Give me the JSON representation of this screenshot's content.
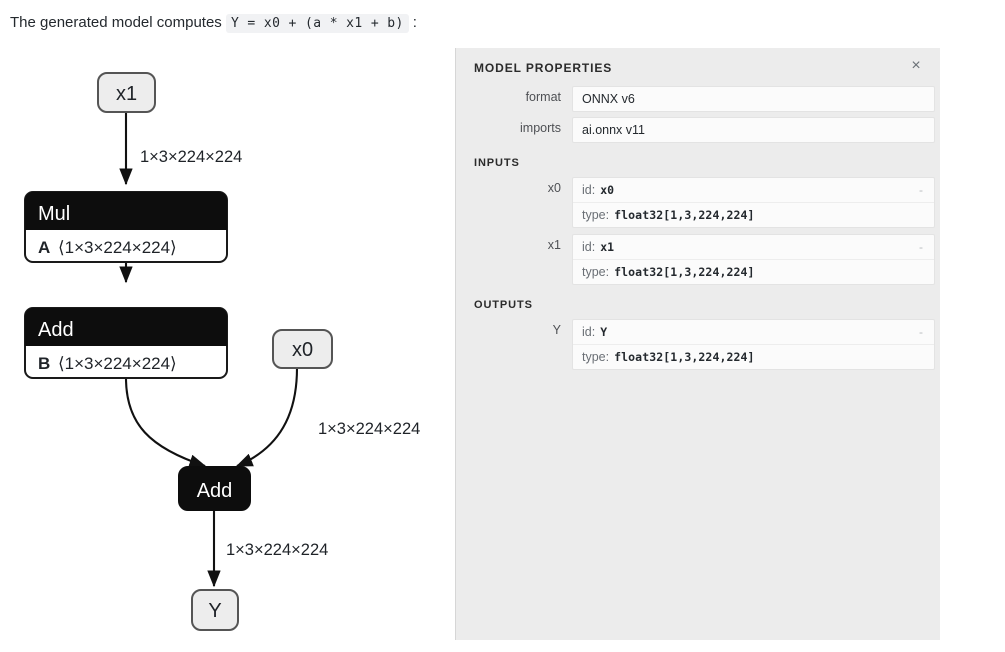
{
  "intro": {
    "text_before": "The generated model computes",
    "code": "Y = x0 + (a * x1 + b)",
    "text_after": ":"
  },
  "clipped_glyph": "}",
  "graph": {
    "nodes": [
      {
        "id": "x1",
        "kind": "io",
        "label": "x1"
      },
      {
        "id": "mul",
        "kind": "op",
        "title": "Mul",
        "arg_name": "A",
        "arg_shape": "⟨1×3×224×224⟩"
      },
      {
        "id": "add1",
        "kind": "op",
        "title": "Add",
        "arg_name": "B",
        "arg_shape": "⟨1×3×224×224⟩"
      },
      {
        "id": "x0",
        "kind": "io",
        "label": "x0"
      },
      {
        "id": "add2",
        "kind": "op-simple",
        "title": "Add"
      },
      {
        "id": "Y",
        "kind": "io",
        "label": "Y"
      }
    ],
    "edge_labels": {
      "x1_to_mul": "1×3×224×224",
      "x0_to_add2": "1×3×224×224",
      "add2_to_Y": "1×3×224×224"
    },
    "colors": {
      "op_header_bg": "#0d0d0d",
      "op_body_bg": "#ffffff",
      "io_bg": "#ededed",
      "io_border": "#555555",
      "edge": "#1a1a1a",
      "op_title_text": "#ffffff"
    }
  },
  "panel": {
    "title": "MODEL PROPERTIES",
    "close_icon": "×",
    "properties": [
      {
        "label": "format",
        "value": "ONNX v6"
      },
      {
        "label": "imports",
        "value": "ai.onnx v11"
      }
    ],
    "inputs_section_title": "INPUTS",
    "inputs": [
      {
        "name": "x0",
        "id_key": "id:",
        "id_value": "x0",
        "type_key": "type:",
        "type_value": "float32[1,3,224,224]",
        "trailing": "-"
      },
      {
        "name": "x1",
        "id_key": "id:",
        "id_value": "x1",
        "type_key": "type:",
        "type_value": "float32[1,3,224,224]",
        "trailing": "-"
      }
    ],
    "outputs_section_title": "OUTPUTS",
    "outputs": [
      {
        "name": "Y",
        "id_key": "id:",
        "id_value": "Y",
        "type_key": "type:",
        "type_value": "float32[1,3,224,224]",
        "trailing": "-"
      }
    ],
    "colors": {
      "panel_bg": "#ececec",
      "field_bg": "#fbfbfb",
      "field_border": "#e3e3e3"
    }
  }
}
